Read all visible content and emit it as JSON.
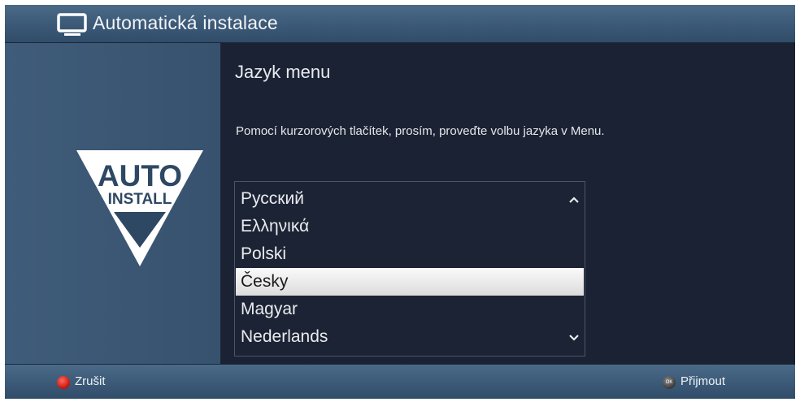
{
  "header": {
    "title": "Automatická instalace",
    "icon": "tv-icon"
  },
  "logo": {
    "line1": "AUTO",
    "line2": "INSTALL"
  },
  "main": {
    "section_title": "Jazyk menu",
    "instruction": "Pomocí kurzorových tlačítek, prosím, proveďte volbu jazyka v Menu.",
    "languages": [
      "Русский",
      "Ελληνικά",
      "Polski",
      "Česky",
      "Magyar",
      "Nederlands"
    ],
    "selected_language": "Česky"
  },
  "footer": {
    "cancel_label": "Zrušit",
    "cancel_button_color": "#d21a12",
    "ok_glyph": "OK",
    "accept_label": "Přijmout"
  },
  "colors": {
    "bar": "#3a5876",
    "background": "#1b2233",
    "side_panel": "#3d5977",
    "highlight": "#eeeeee"
  }
}
